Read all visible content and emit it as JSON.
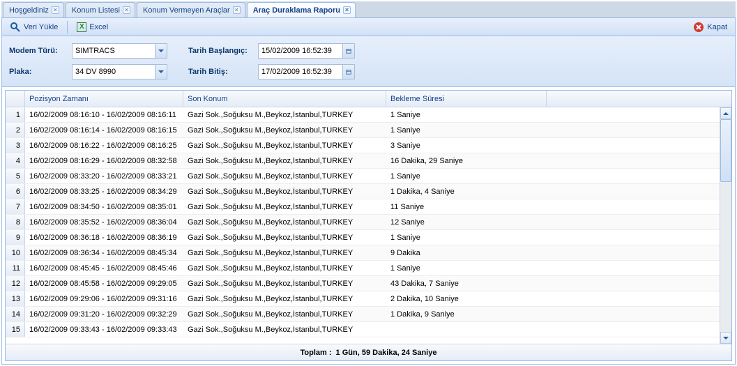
{
  "tabs": [
    {
      "label": "Hoşgeldiniz"
    },
    {
      "label": "Konum Listesi"
    },
    {
      "label": "Konum Vermeyen Araçlar"
    },
    {
      "label": "Araç Duraklama Raporu"
    }
  ],
  "activeTab": 3,
  "toolbar": {
    "load_label": "Veri Yükle",
    "excel_label": "Excel",
    "close_label": "Kapat"
  },
  "filters": {
    "modem_label": "Modem Türü:",
    "modem_value": "SIMTRACS",
    "plaka_label": "Plaka:",
    "plaka_value": "34 DV 8990",
    "start_label": "Tarih Başlangıç:",
    "start_value": "15/02/2009 16:52:39",
    "end_label": "Tarih Bitiş:",
    "end_value": "17/02/2009 16:52:39"
  },
  "grid": {
    "columns": [
      "Pozisyon Zamanı",
      "Son Konum",
      "Bekleme Süresi"
    ],
    "rows": [
      {
        "n": 1,
        "time": "16/02/2009 08:16:10 - 16/02/2009 08:16:11",
        "loc": "Gazi Sok.,Soğuksu M.,Beykoz,İstanbul,TURKEY",
        "wait": "1 Saniye"
      },
      {
        "n": 2,
        "time": "16/02/2009 08:16:14 - 16/02/2009 08:16:15",
        "loc": "Gazi Sok.,Soğuksu M.,Beykoz,İstanbul,TURKEY",
        "wait": "1 Saniye"
      },
      {
        "n": 3,
        "time": "16/02/2009 08:16:22 - 16/02/2009 08:16:25",
        "loc": "Gazi Sok.,Soğuksu M.,Beykoz,İstanbul,TURKEY",
        "wait": "3 Saniye"
      },
      {
        "n": 4,
        "time": "16/02/2009 08:16:29 - 16/02/2009 08:32:58",
        "loc": "Gazi Sok.,Soğuksu M.,Beykoz,İstanbul,TURKEY",
        "wait": "16 Dakika, 29 Saniye"
      },
      {
        "n": 5,
        "time": "16/02/2009 08:33:20 - 16/02/2009 08:33:21",
        "loc": "Gazi Sok.,Soğuksu M.,Beykoz,İstanbul,TURKEY",
        "wait": "1 Saniye"
      },
      {
        "n": 6,
        "time": "16/02/2009 08:33:25 - 16/02/2009 08:34:29",
        "loc": "Gazi Sok.,Soğuksu M.,Beykoz,İstanbul,TURKEY",
        "wait": "1 Dakika, 4 Saniye"
      },
      {
        "n": 7,
        "time": "16/02/2009 08:34:50 - 16/02/2009 08:35:01",
        "loc": "Gazi Sok.,Soğuksu M.,Beykoz,İstanbul,TURKEY",
        "wait": "11 Saniye"
      },
      {
        "n": 8,
        "time": "16/02/2009 08:35:52 - 16/02/2009 08:36:04",
        "loc": "Gazi Sok.,Soğuksu M.,Beykoz,İstanbul,TURKEY",
        "wait": "12 Saniye"
      },
      {
        "n": 9,
        "time": "16/02/2009 08:36:18 - 16/02/2009 08:36:19",
        "loc": "Gazi Sok.,Soğuksu M.,Beykoz,İstanbul,TURKEY",
        "wait": "1 Saniye"
      },
      {
        "n": 10,
        "time": "16/02/2009 08:36:34 - 16/02/2009 08:45:34",
        "loc": "Gazi Sok.,Soğuksu M.,Beykoz,İstanbul,TURKEY",
        "wait": "9 Dakika"
      },
      {
        "n": 11,
        "time": "16/02/2009 08:45:45 - 16/02/2009 08:45:46",
        "loc": "Gazi Sok.,Soğuksu M.,Beykoz,İstanbul,TURKEY",
        "wait": "1 Saniye"
      },
      {
        "n": 12,
        "time": "16/02/2009 08:45:58 - 16/02/2009 09:29:05",
        "loc": "Gazi Sok.,Soğuksu M.,Beykoz,İstanbul,TURKEY",
        "wait": "43 Dakika, 7 Saniye"
      },
      {
        "n": 13,
        "time": "16/02/2009 09:29:06 - 16/02/2009 09:31:16",
        "loc": "Gazi Sok.,Soğuksu M.,Beykoz,İstanbul,TURKEY",
        "wait": "2 Dakika, 10 Saniye"
      },
      {
        "n": 14,
        "time": "16/02/2009 09:31:20 - 16/02/2009 09:32:29",
        "loc": "Gazi Sok.,Soğuksu M.,Beykoz,İstanbul,TURKEY",
        "wait": "1 Dakika, 9 Saniye"
      },
      {
        "n": 15,
        "time": "16/02/2009 09:33:43 - 16/02/2009 09:33:43",
        "loc": "Gazi Sok.,Soğuksu M.,Beykoz,İstanbul,TURKEY",
        "wait": ""
      }
    ],
    "footer_label": "Toplam :",
    "footer_value": "1 Gün, 59 Dakika, 24 Saniye"
  }
}
